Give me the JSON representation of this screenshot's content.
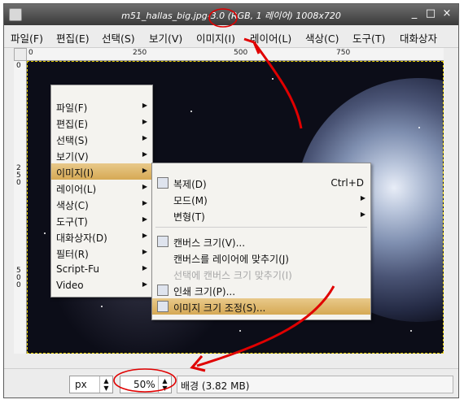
{
  "window": {
    "title": "m51_hallas_big.jpg-3.0 (RGB, 1 레이어) 1008x720",
    "buttons": [
      "_",
      "□",
      "×"
    ]
  },
  "menubar": {
    "items": [
      "파일(F)",
      "편집(E)",
      "선택(S)",
      "보기(V)",
      "이미지(I)",
      "레이어(L)",
      "색상(C)",
      "도구(T)",
      "대화상자"
    ]
  },
  "ruler": {
    "h_ticks": [
      "0",
      "250",
      "500",
      "750"
    ],
    "v_ticks": [
      "0",
      "250",
      "500"
    ]
  },
  "context_menu": {
    "items": [
      {
        "label": "파일(F)"
      },
      {
        "label": "편집(E)"
      },
      {
        "label": "선택(S)"
      },
      {
        "label": "보기(V)"
      },
      {
        "label": "이미지(I)",
        "highlighted": true
      },
      {
        "label": "레이어(L)"
      },
      {
        "label": "색상(C)"
      },
      {
        "label": "도구(T)"
      },
      {
        "label": "대화상자(D)"
      },
      {
        "label": "필터(R)"
      },
      {
        "label": "Script-Fu"
      },
      {
        "label": "Video"
      }
    ]
  },
  "submenu": {
    "items": [
      {
        "label": "복제(D)",
        "shortcut": "Ctrl+D",
        "icon": "duplicate-icon"
      },
      {
        "label": "모드(M)"
      },
      {
        "label": "변형(T)"
      },
      {
        "label": "캔버스 크기(V)...",
        "icon": "canvas-size-icon"
      },
      {
        "label": "캔버스를 레이어에 맞추기(J)"
      },
      {
        "label": "선택에 캔버스 크기 맞추기(I)",
        "disabled": true
      },
      {
        "label": "인쇄 크기(P)...",
        "icon": "print-size-icon"
      },
      {
        "label": "이미지 크기 조정(S)...",
        "icon": "scale-image-icon",
        "highlighted": true
      }
    ]
  },
  "status": {
    "unit": "px",
    "zoom": "50%",
    "message": "배경 (3.82 MB)"
  },
  "colors": {
    "highlight": "#d6a954",
    "annotation": "#e00000",
    "canvas_bg": "#0c0d18"
  }
}
